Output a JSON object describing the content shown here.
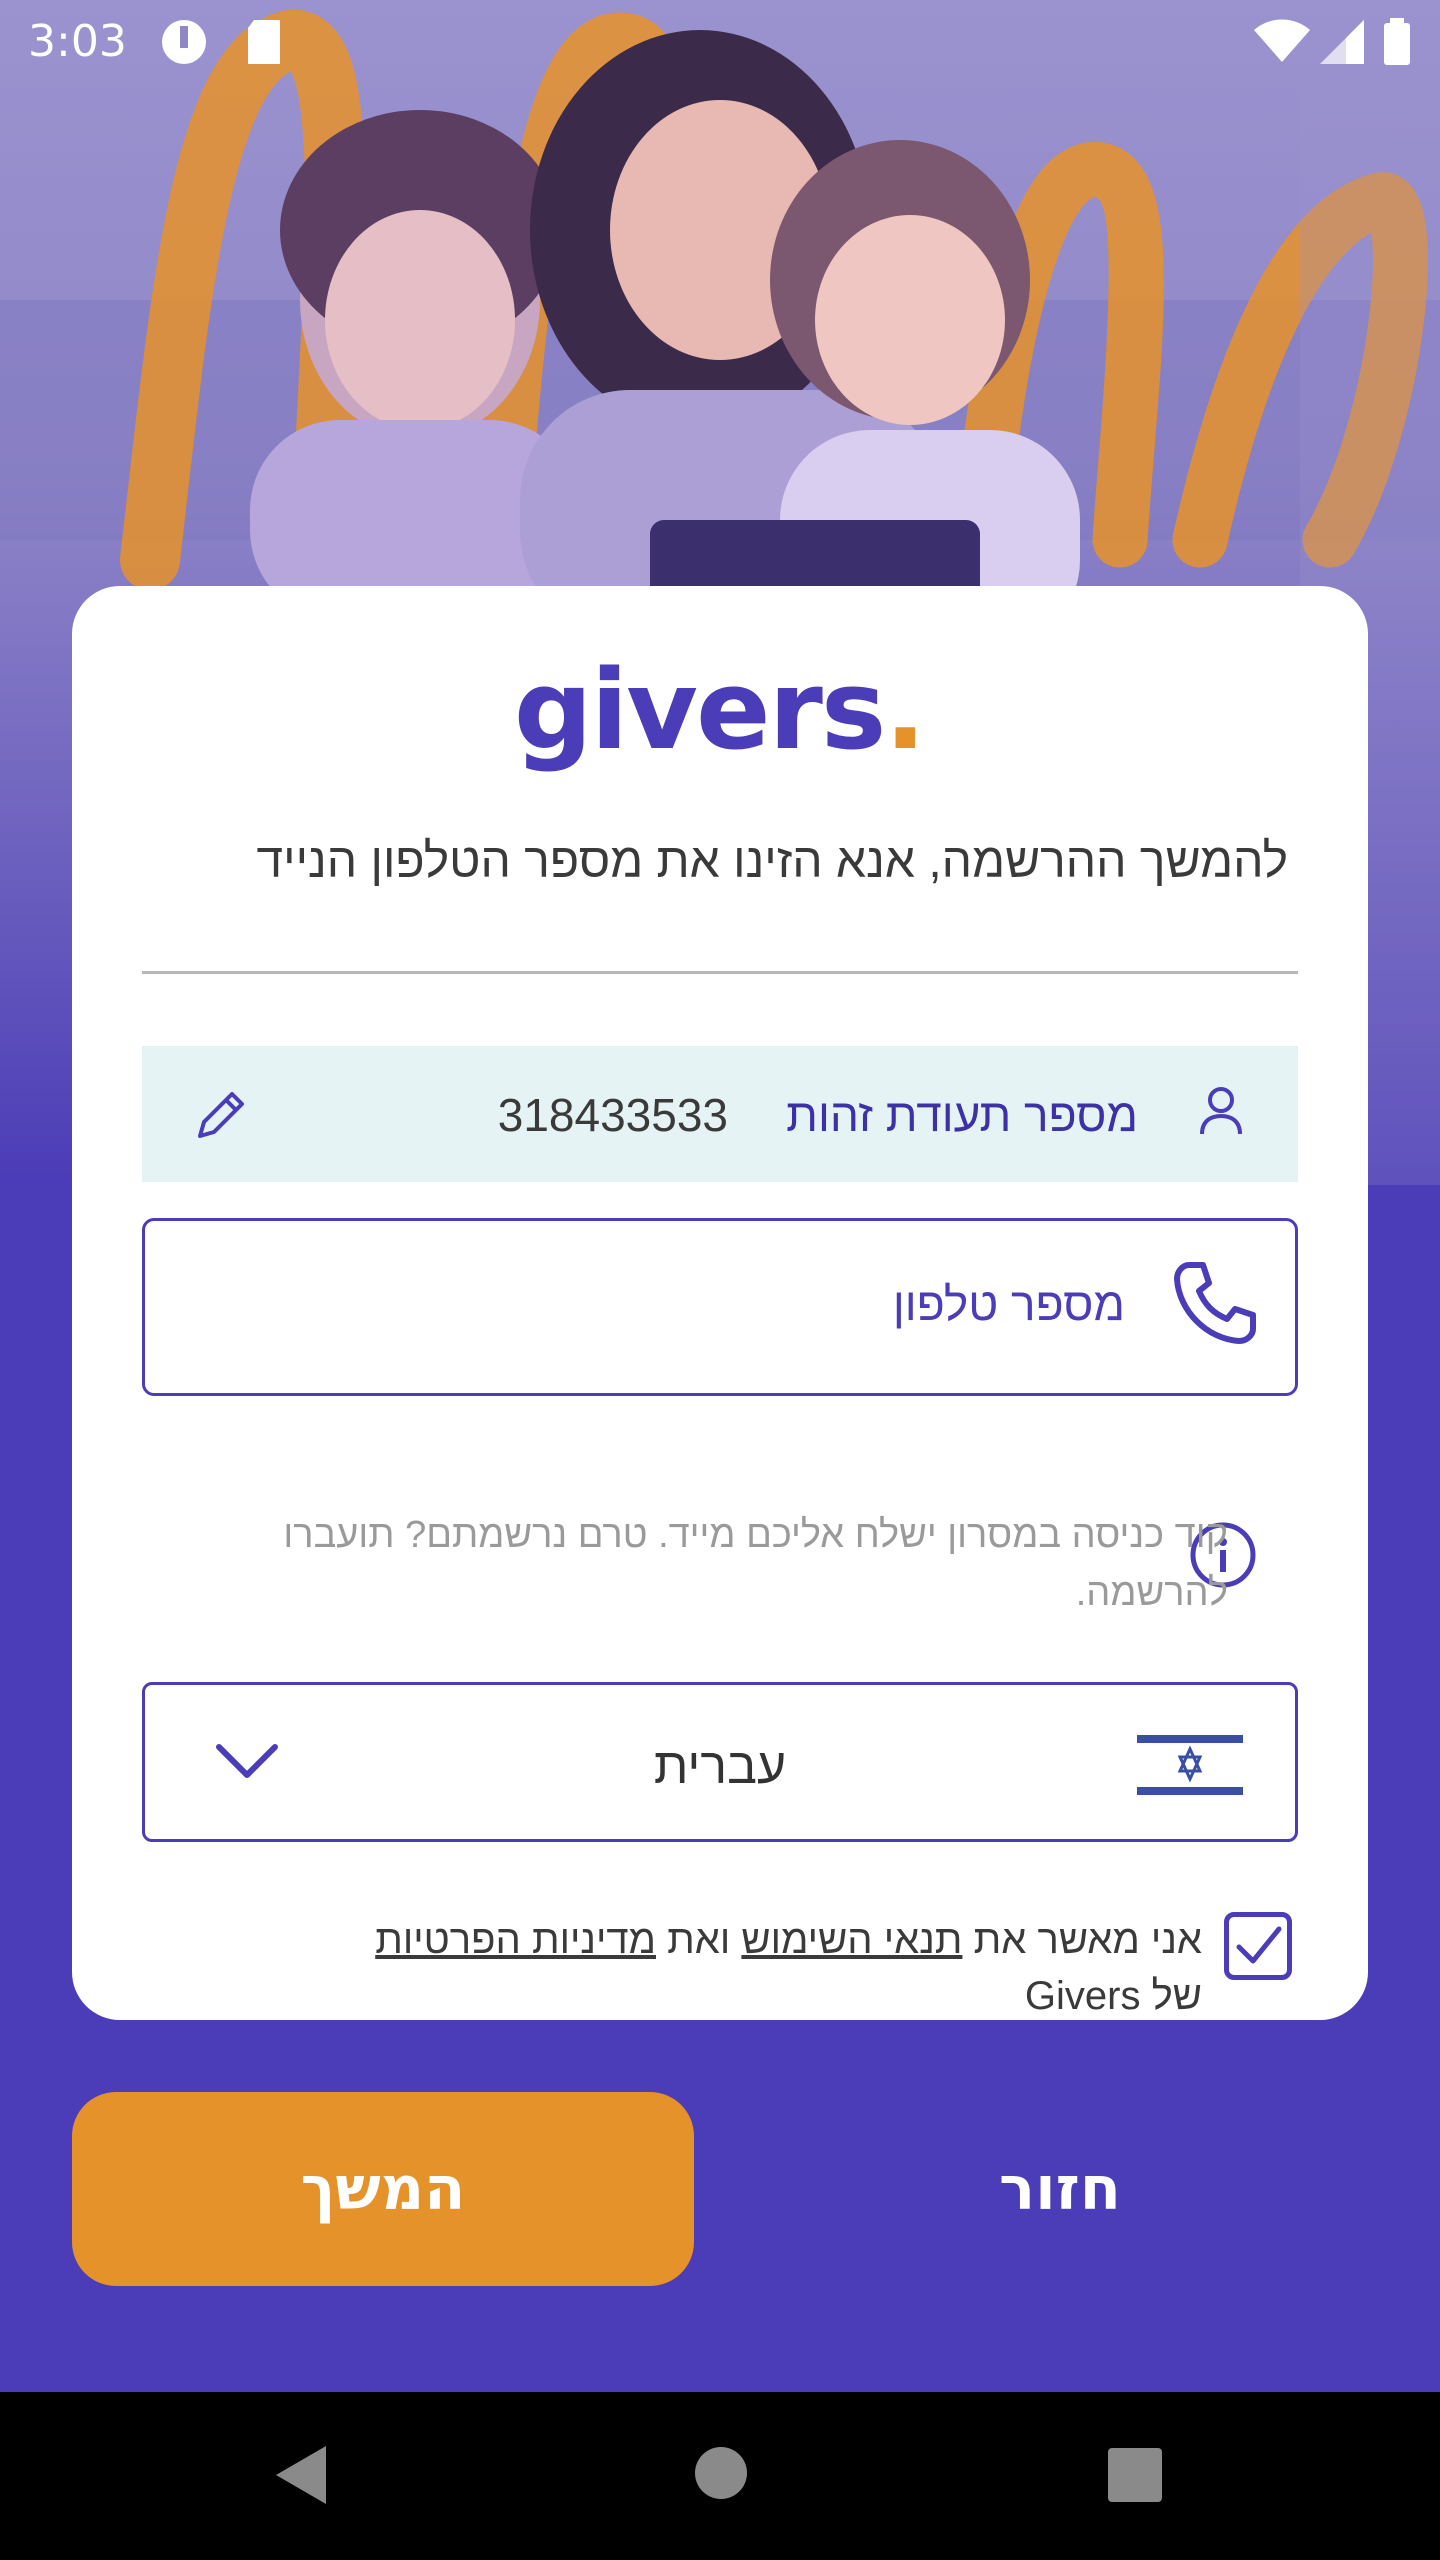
{
  "status_bar": {
    "time": "3:03"
  },
  "brand": {
    "logo_text": "givers",
    "logo_dot": ".",
    "primary_color": "#4b3cb7",
    "accent_color": "#e6922a"
  },
  "form": {
    "headline": "להמשך ההרשמה, אנא הזינו את מספר הטלפון הנייד",
    "id_field": {
      "label": "מספר תעודת זהות",
      "value": "318433533"
    },
    "phone_field": {
      "placeholder": "מספר טלפון"
    },
    "info_text": "קוד כניסה במסרון ישלח אליכם מייד. טרם נרשמתם? תועברו להרשמה.",
    "language_select": {
      "value": "עברית"
    },
    "terms": {
      "prefix": "אני מאשר את",
      "terms_link": "תנאי השימוש",
      "and": "ואת",
      "privacy_link": "מדיניות הפרטיות",
      "suffix": "של Givers",
      "checked": true
    }
  },
  "actions": {
    "continue_label": "המשך",
    "back_label": "חזור"
  },
  "icons": [
    "user-icon",
    "edit-icon",
    "phone-icon",
    "info-icon",
    "israel-flag-icon",
    "chevron-down-icon",
    "checkbox-icon",
    "back-nav-icon",
    "home-nav-icon",
    "recents-nav-icon"
  ]
}
